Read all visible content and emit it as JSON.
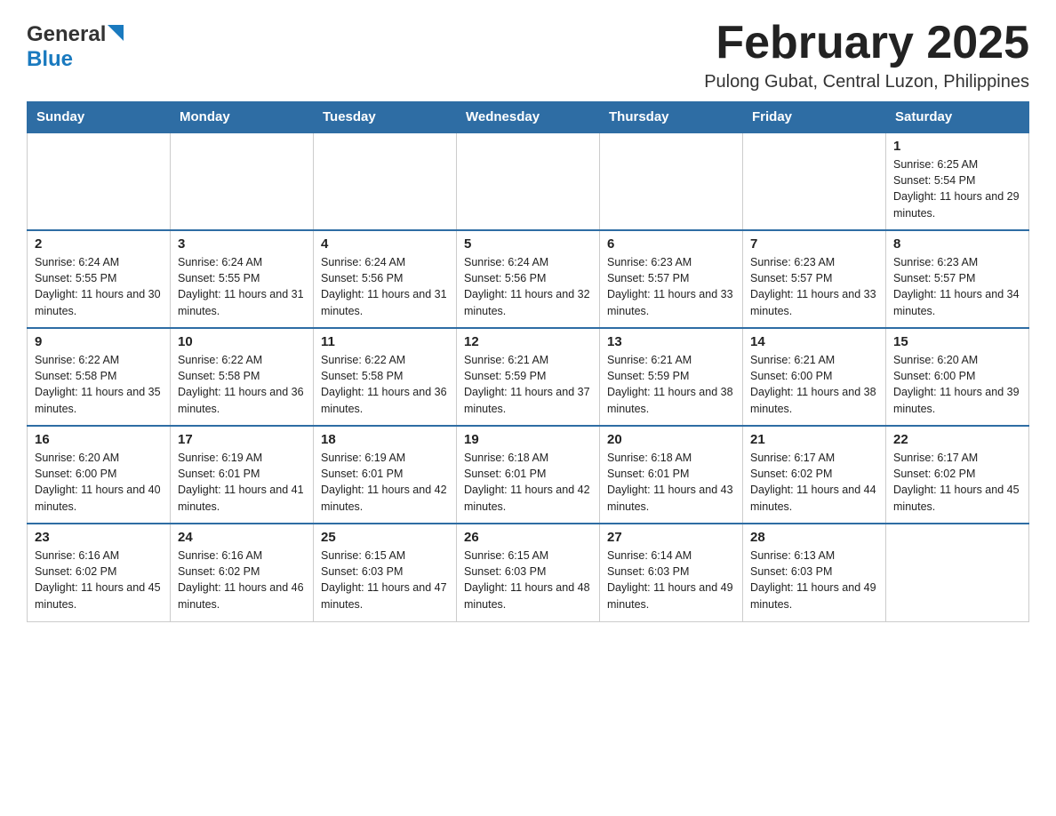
{
  "header": {
    "logo": {
      "general": "General",
      "blue": "Blue"
    },
    "title": "February 2025",
    "location": "Pulong Gubat, Central Luzon, Philippines"
  },
  "calendar": {
    "headers": [
      "Sunday",
      "Monday",
      "Tuesday",
      "Wednesday",
      "Thursday",
      "Friday",
      "Saturday"
    ],
    "weeks": [
      [
        {
          "day": "",
          "info": ""
        },
        {
          "day": "",
          "info": ""
        },
        {
          "day": "",
          "info": ""
        },
        {
          "day": "",
          "info": ""
        },
        {
          "day": "",
          "info": ""
        },
        {
          "day": "",
          "info": ""
        },
        {
          "day": "1",
          "info": "Sunrise: 6:25 AM\nSunset: 5:54 PM\nDaylight: 11 hours and 29 minutes."
        }
      ],
      [
        {
          "day": "2",
          "info": "Sunrise: 6:24 AM\nSunset: 5:55 PM\nDaylight: 11 hours and 30 minutes."
        },
        {
          "day": "3",
          "info": "Sunrise: 6:24 AM\nSunset: 5:55 PM\nDaylight: 11 hours and 31 minutes."
        },
        {
          "day": "4",
          "info": "Sunrise: 6:24 AM\nSunset: 5:56 PM\nDaylight: 11 hours and 31 minutes."
        },
        {
          "day": "5",
          "info": "Sunrise: 6:24 AM\nSunset: 5:56 PM\nDaylight: 11 hours and 32 minutes."
        },
        {
          "day": "6",
          "info": "Sunrise: 6:23 AM\nSunset: 5:57 PM\nDaylight: 11 hours and 33 minutes."
        },
        {
          "day": "7",
          "info": "Sunrise: 6:23 AM\nSunset: 5:57 PM\nDaylight: 11 hours and 33 minutes."
        },
        {
          "day": "8",
          "info": "Sunrise: 6:23 AM\nSunset: 5:57 PM\nDaylight: 11 hours and 34 minutes."
        }
      ],
      [
        {
          "day": "9",
          "info": "Sunrise: 6:22 AM\nSunset: 5:58 PM\nDaylight: 11 hours and 35 minutes."
        },
        {
          "day": "10",
          "info": "Sunrise: 6:22 AM\nSunset: 5:58 PM\nDaylight: 11 hours and 36 minutes."
        },
        {
          "day": "11",
          "info": "Sunrise: 6:22 AM\nSunset: 5:58 PM\nDaylight: 11 hours and 36 minutes."
        },
        {
          "day": "12",
          "info": "Sunrise: 6:21 AM\nSunset: 5:59 PM\nDaylight: 11 hours and 37 minutes."
        },
        {
          "day": "13",
          "info": "Sunrise: 6:21 AM\nSunset: 5:59 PM\nDaylight: 11 hours and 38 minutes."
        },
        {
          "day": "14",
          "info": "Sunrise: 6:21 AM\nSunset: 6:00 PM\nDaylight: 11 hours and 38 minutes."
        },
        {
          "day": "15",
          "info": "Sunrise: 6:20 AM\nSunset: 6:00 PM\nDaylight: 11 hours and 39 minutes."
        }
      ],
      [
        {
          "day": "16",
          "info": "Sunrise: 6:20 AM\nSunset: 6:00 PM\nDaylight: 11 hours and 40 minutes."
        },
        {
          "day": "17",
          "info": "Sunrise: 6:19 AM\nSunset: 6:01 PM\nDaylight: 11 hours and 41 minutes."
        },
        {
          "day": "18",
          "info": "Sunrise: 6:19 AM\nSunset: 6:01 PM\nDaylight: 11 hours and 42 minutes."
        },
        {
          "day": "19",
          "info": "Sunrise: 6:18 AM\nSunset: 6:01 PM\nDaylight: 11 hours and 42 minutes."
        },
        {
          "day": "20",
          "info": "Sunrise: 6:18 AM\nSunset: 6:01 PM\nDaylight: 11 hours and 43 minutes."
        },
        {
          "day": "21",
          "info": "Sunrise: 6:17 AM\nSunset: 6:02 PM\nDaylight: 11 hours and 44 minutes."
        },
        {
          "day": "22",
          "info": "Sunrise: 6:17 AM\nSunset: 6:02 PM\nDaylight: 11 hours and 45 minutes."
        }
      ],
      [
        {
          "day": "23",
          "info": "Sunrise: 6:16 AM\nSunset: 6:02 PM\nDaylight: 11 hours and 45 minutes."
        },
        {
          "day": "24",
          "info": "Sunrise: 6:16 AM\nSunset: 6:02 PM\nDaylight: 11 hours and 46 minutes."
        },
        {
          "day": "25",
          "info": "Sunrise: 6:15 AM\nSunset: 6:03 PM\nDaylight: 11 hours and 47 minutes."
        },
        {
          "day": "26",
          "info": "Sunrise: 6:15 AM\nSunset: 6:03 PM\nDaylight: 11 hours and 48 minutes."
        },
        {
          "day": "27",
          "info": "Sunrise: 6:14 AM\nSunset: 6:03 PM\nDaylight: 11 hours and 49 minutes."
        },
        {
          "day": "28",
          "info": "Sunrise: 6:13 AM\nSunset: 6:03 PM\nDaylight: 11 hours and 49 minutes."
        },
        {
          "day": "",
          "info": ""
        }
      ]
    ]
  }
}
